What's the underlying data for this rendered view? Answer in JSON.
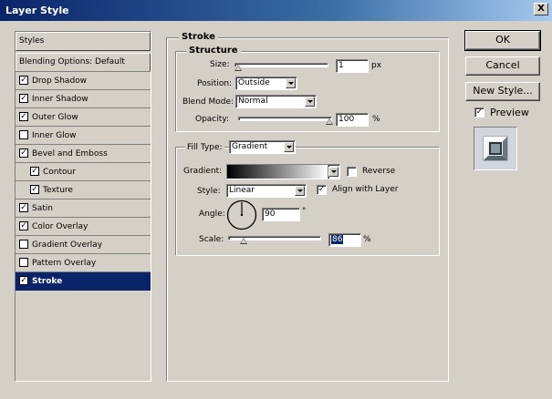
{
  "window": {
    "title": "Layer Style",
    "close_label": "X"
  },
  "sidebar": {
    "header": "Styles",
    "blending": "Blending Options: Default",
    "items": [
      {
        "label": "Drop Shadow",
        "checked": true,
        "indent": false,
        "selected": false
      },
      {
        "label": "Inner Shadow",
        "checked": true,
        "indent": false,
        "selected": false
      },
      {
        "label": "Outer Glow",
        "checked": true,
        "indent": false,
        "selected": false
      },
      {
        "label": "Inner Glow",
        "checked": false,
        "indent": false,
        "selected": false
      },
      {
        "label": "Bevel and Emboss",
        "checked": true,
        "indent": false,
        "selected": false
      },
      {
        "label": "Contour",
        "checked": true,
        "indent": true,
        "selected": false
      },
      {
        "label": "Texture",
        "checked": true,
        "indent": true,
        "selected": false
      },
      {
        "label": "Satin",
        "checked": true,
        "indent": false,
        "selected": false
      },
      {
        "label": "Color Overlay",
        "checked": true,
        "indent": false,
        "selected": false
      },
      {
        "label": "Gradient Overlay",
        "checked": false,
        "indent": false,
        "selected": false
      },
      {
        "label": "Pattern Overlay",
        "checked": false,
        "indent": false,
        "selected": false
      },
      {
        "label": "Stroke",
        "checked": true,
        "indent": false,
        "selected": true
      }
    ]
  },
  "stroke": {
    "section_title": "Stroke",
    "structure_title": "Structure",
    "size_label": "Size:",
    "size_value": "1",
    "size_unit": "px",
    "position_label": "Position:",
    "position_value": "Outside",
    "blend_label": "Blend Mode:",
    "blend_value": "Normal",
    "opacity_label": "Opacity:",
    "opacity_value": "100",
    "opacity_unit": "%",
    "fill_type_label": "Fill Type:",
    "fill_type_value": "Gradient",
    "gradient_label": "Gradient:",
    "reverse_label": "Reverse",
    "reverse_checked": false,
    "style_label": "Style:",
    "style_value": "Linear",
    "align_label": "Align with Layer",
    "align_checked": true,
    "angle_label": "Angle:",
    "angle_value": "90",
    "angle_unit": "°",
    "scale_label": "Scale:",
    "scale_value": "86",
    "scale_unit": "%"
  },
  "buttons": {
    "ok": "OK",
    "cancel": "Cancel",
    "new_style": "New Style..."
  },
  "preview": {
    "label": "Preview",
    "checked": true
  },
  "check_glyph": "✓"
}
